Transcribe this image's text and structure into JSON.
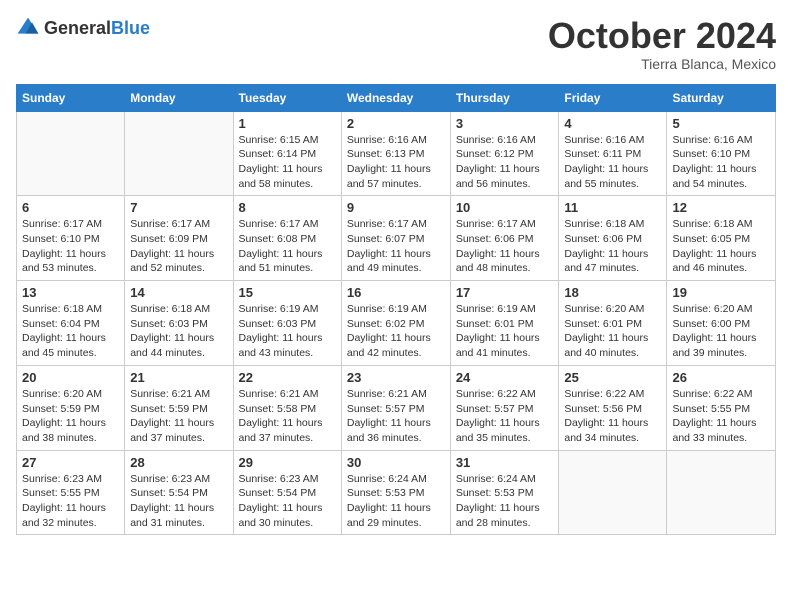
{
  "logo": {
    "general": "General",
    "blue": "Blue"
  },
  "title": "October 2024",
  "location": "Tierra Blanca, Mexico",
  "days_of_week": [
    "Sunday",
    "Monday",
    "Tuesday",
    "Wednesday",
    "Thursday",
    "Friday",
    "Saturday"
  ],
  "weeks": [
    [
      {
        "day": "",
        "sunrise": "",
        "sunset": "",
        "daylight": ""
      },
      {
        "day": "",
        "sunrise": "",
        "sunset": "",
        "daylight": ""
      },
      {
        "day": "1",
        "sunrise": "Sunrise: 6:15 AM",
        "sunset": "Sunset: 6:14 PM",
        "daylight": "Daylight: 11 hours and 58 minutes."
      },
      {
        "day": "2",
        "sunrise": "Sunrise: 6:16 AM",
        "sunset": "Sunset: 6:13 PM",
        "daylight": "Daylight: 11 hours and 57 minutes."
      },
      {
        "day": "3",
        "sunrise": "Sunrise: 6:16 AM",
        "sunset": "Sunset: 6:12 PM",
        "daylight": "Daylight: 11 hours and 56 minutes."
      },
      {
        "day": "4",
        "sunrise": "Sunrise: 6:16 AM",
        "sunset": "Sunset: 6:11 PM",
        "daylight": "Daylight: 11 hours and 55 minutes."
      },
      {
        "day": "5",
        "sunrise": "Sunrise: 6:16 AM",
        "sunset": "Sunset: 6:10 PM",
        "daylight": "Daylight: 11 hours and 54 minutes."
      }
    ],
    [
      {
        "day": "6",
        "sunrise": "Sunrise: 6:17 AM",
        "sunset": "Sunset: 6:10 PM",
        "daylight": "Daylight: 11 hours and 53 minutes."
      },
      {
        "day": "7",
        "sunrise": "Sunrise: 6:17 AM",
        "sunset": "Sunset: 6:09 PM",
        "daylight": "Daylight: 11 hours and 52 minutes."
      },
      {
        "day": "8",
        "sunrise": "Sunrise: 6:17 AM",
        "sunset": "Sunset: 6:08 PM",
        "daylight": "Daylight: 11 hours and 51 minutes."
      },
      {
        "day": "9",
        "sunrise": "Sunrise: 6:17 AM",
        "sunset": "Sunset: 6:07 PM",
        "daylight": "Daylight: 11 hours and 49 minutes."
      },
      {
        "day": "10",
        "sunrise": "Sunrise: 6:17 AM",
        "sunset": "Sunset: 6:06 PM",
        "daylight": "Daylight: 11 hours and 48 minutes."
      },
      {
        "day": "11",
        "sunrise": "Sunrise: 6:18 AM",
        "sunset": "Sunset: 6:06 PM",
        "daylight": "Daylight: 11 hours and 47 minutes."
      },
      {
        "day": "12",
        "sunrise": "Sunrise: 6:18 AM",
        "sunset": "Sunset: 6:05 PM",
        "daylight": "Daylight: 11 hours and 46 minutes."
      }
    ],
    [
      {
        "day": "13",
        "sunrise": "Sunrise: 6:18 AM",
        "sunset": "Sunset: 6:04 PM",
        "daylight": "Daylight: 11 hours and 45 minutes."
      },
      {
        "day": "14",
        "sunrise": "Sunrise: 6:18 AM",
        "sunset": "Sunset: 6:03 PM",
        "daylight": "Daylight: 11 hours and 44 minutes."
      },
      {
        "day": "15",
        "sunrise": "Sunrise: 6:19 AM",
        "sunset": "Sunset: 6:03 PM",
        "daylight": "Daylight: 11 hours and 43 minutes."
      },
      {
        "day": "16",
        "sunrise": "Sunrise: 6:19 AM",
        "sunset": "Sunset: 6:02 PM",
        "daylight": "Daylight: 11 hours and 42 minutes."
      },
      {
        "day": "17",
        "sunrise": "Sunrise: 6:19 AM",
        "sunset": "Sunset: 6:01 PM",
        "daylight": "Daylight: 11 hours and 41 minutes."
      },
      {
        "day": "18",
        "sunrise": "Sunrise: 6:20 AM",
        "sunset": "Sunset: 6:01 PM",
        "daylight": "Daylight: 11 hours and 40 minutes."
      },
      {
        "day": "19",
        "sunrise": "Sunrise: 6:20 AM",
        "sunset": "Sunset: 6:00 PM",
        "daylight": "Daylight: 11 hours and 39 minutes."
      }
    ],
    [
      {
        "day": "20",
        "sunrise": "Sunrise: 6:20 AM",
        "sunset": "Sunset: 5:59 PM",
        "daylight": "Daylight: 11 hours and 38 minutes."
      },
      {
        "day": "21",
        "sunrise": "Sunrise: 6:21 AM",
        "sunset": "Sunset: 5:59 PM",
        "daylight": "Daylight: 11 hours and 37 minutes."
      },
      {
        "day": "22",
        "sunrise": "Sunrise: 6:21 AM",
        "sunset": "Sunset: 5:58 PM",
        "daylight": "Daylight: 11 hours and 37 minutes."
      },
      {
        "day": "23",
        "sunrise": "Sunrise: 6:21 AM",
        "sunset": "Sunset: 5:57 PM",
        "daylight": "Daylight: 11 hours and 36 minutes."
      },
      {
        "day": "24",
        "sunrise": "Sunrise: 6:22 AM",
        "sunset": "Sunset: 5:57 PM",
        "daylight": "Daylight: 11 hours and 35 minutes."
      },
      {
        "day": "25",
        "sunrise": "Sunrise: 6:22 AM",
        "sunset": "Sunset: 5:56 PM",
        "daylight": "Daylight: 11 hours and 34 minutes."
      },
      {
        "day": "26",
        "sunrise": "Sunrise: 6:22 AM",
        "sunset": "Sunset: 5:55 PM",
        "daylight": "Daylight: 11 hours and 33 minutes."
      }
    ],
    [
      {
        "day": "27",
        "sunrise": "Sunrise: 6:23 AM",
        "sunset": "Sunset: 5:55 PM",
        "daylight": "Daylight: 11 hours and 32 minutes."
      },
      {
        "day": "28",
        "sunrise": "Sunrise: 6:23 AM",
        "sunset": "Sunset: 5:54 PM",
        "daylight": "Daylight: 11 hours and 31 minutes."
      },
      {
        "day": "29",
        "sunrise": "Sunrise: 6:23 AM",
        "sunset": "Sunset: 5:54 PM",
        "daylight": "Daylight: 11 hours and 30 minutes."
      },
      {
        "day": "30",
        "sunrise": "Sunrise: 6:24 AM",
        "sunset": "Sunset: 5:53 PM",
        "daylight": "Daylight: 11 hours and 29 minutes."
      },
      {
        "day": "31",
        "sunrise": "Sunrise: 6:24 AM",
        "sunset": "Sunset: 5:53 PM",
        "daylight": "Daylight: 11 hours and 28 minutes."
      },
      {
        "day": "",
        "sunrise": "",
        "sunset": "",
        "daylight": ""
      },
      {
        "day": "",
        "sunrise": "",
        "sunset": "",
        "daylight": ""
      }
    ]
  ]
}
